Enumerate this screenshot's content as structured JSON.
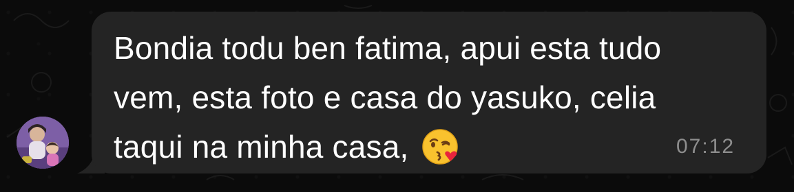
{
  "message": {
    "lines": [
      "Bondia todu ben fatima, apui esta tudo",
      "vem, esta foto e casa do yasuko, celia",
      "taqui na minha casa,"
    ],
    "emoji": "kissing-face-with-heart-emoji",
    "time": "07:12"
  },
  "colors": {
    "background": "#0b0b0b",
    "bubble": "#242424",
    "text": "#ffffff",
    "timestamp": "#8e8e8e"
  }
}
